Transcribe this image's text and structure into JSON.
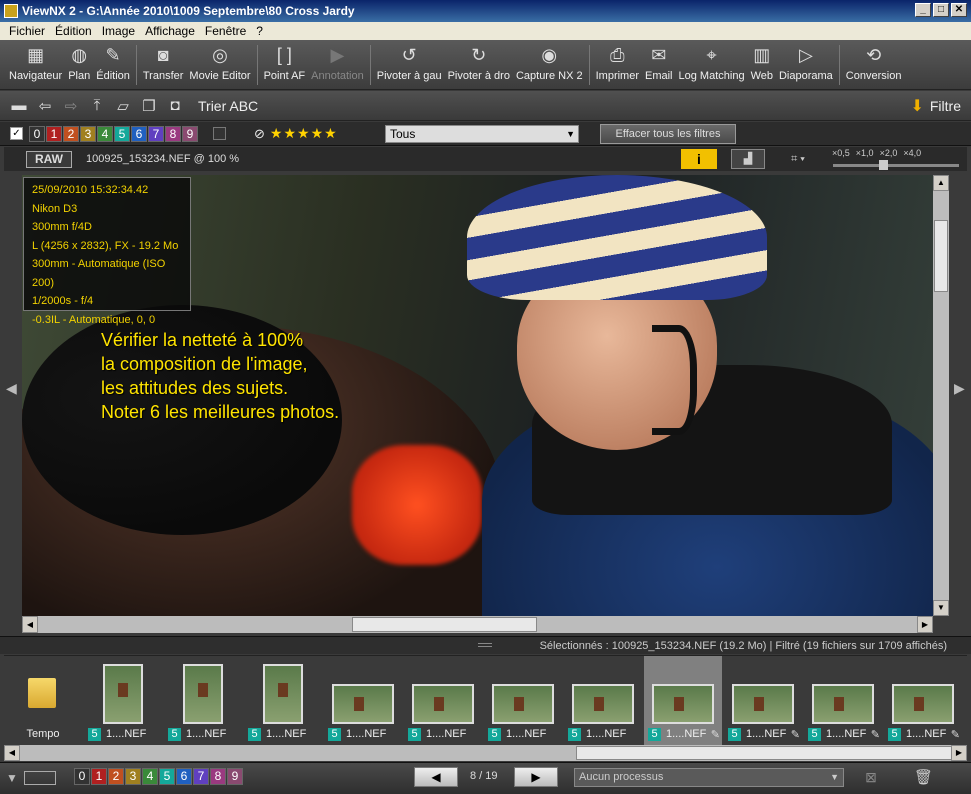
{
  "window": {
    "title": "ViewNX 2 - G:\\Année 2010\\1009 Septembre\\80 Cross Jardy"
  },
  "menu": [
    "Fichier",
    "Édition",
    "Image",
    "Affichage",
    "Fenêtre",
    "?"
  ],
  "toolbar": [
    {
      "label": "Navigateur",
      "icon": "navigator-icon",
      "glyph": "▦",
      "enabled": true
    },
    {
      "label": "Plan",
      "icon": "globe-icon",
      "glyph": "◍",
      "enabled": true
    },
    {
      "label": "Édition",
      "icon": "edit-icon",
      "glyph": "✎",
      "enabled": true
    },
    {
      "label": "Transfer",
      "icon": "camera-icon",
      "glyph": "◙",
      "enabled": true
    },
    {
      "label": "Movie Editor",
      "icon": "film-reel-icon",
      "glyph": "◎",
      "enabled": true
    },
    {
      "label": "Point AF",
      "icon": "af-point-icon",
      "glyph": "[ ]",
      "enabled": true
    },
    {
      "label": "Annotation",
      "icon": "play-icon",
      "glyph": "▶",
      "enabled": false
    },
    {
      "label": "Pivoter à gau",
      "icon": "rotate-left-icon",
      "glyph": "↺",
      "enabled": true
    },
    {
      "label": "Pivoter à dro",
      "icon": "rotate-right-icon",
      "glyph": "↻",
      "enabled": true
    },
    {
      "label": "Capture NX 2",
      "icon": "capture-nx-icon",
      "glyph": "◉",
      "enabled": true
    },
    {
      "label": "Imprimer",
      "icon": "printer-icon",
      "glyph": "⎙",
      "enabled": true
    },
    {
      "label": "Email",
      "icon": "email-icon",
      "glyph": "✉",
      "enabled": true
    },
    {
      "label": "Log Matching",
      "icon": "log-matching-icon",
      "glyph": "⌖",
      "enabled": true
    },
    {
      "label": "Web",
      "icon": "web-icon",
      "glyph": "▥",
      "enabled": true
    },
    {
      "label": "Diaporama",
      "icon": "slideshow-icon",
      "glyph": "▷",
      "enabled": true
    },
    {
      "label": "Conversion",
      "icon": "convert-icon",
      "glyph": "⟲",
      "enabled": true
    }
  ],
  "toolbar2": {
    "sort_label": "Trier ABC",
    "filter_label": "Filtre"
  },
  "filters": {
    "labels": [
      "0",
      "1",
      "2",
      "3",
      "4",
      "5",
      "6",
      "7",
      "8",
      "9"
    ],
    "label_colors": [
      "#444444",
      "#b02020",
      "#c05020",
      "#a08020",
      "#3a8a3a",
      "#14a89a",
      "#2060c0",
      "#6040c0",
      "#9a3a80",
      "#8a4a70"
    ],
    "rating_stars": 5,
    "dropdown_value": "Tous",
    "clear_button": "Effacer tous les filtres"
  },
  "viewer": {
    "raw_badge": "RAW",
    "file_zoom": "100925_153234.NEF @ 100 %",
    "info_button": "i",
    "zoom_ticks": [
      "×0,5",
      "×1,0",
      "×2,0",
      "×4,0"
    ],
    "zoom_level_fraction": 0.4
  },
  "exif": [
    "25/09/2010 15:32:34.42",
    "Nikon D3",
    "300mm f/4D",
    "L (4256 x 2832), FX - 19.2 Mo",
    "300mm - Automatique (ISO 200)",
    "1/2000s - f/4",
    "-0.3IL - Automatique, 0, 0"
  ],
  "overlay_note": [
    "Vérifier la netteté à 100%",
    "la composition de l'image,",
    "les attitudes des sujets.",
    "Noter 6 les meilleures photos."
  ],
  "status": {
    "text": "Sélectionnés : 100925_153234.NEF (19.2 Mo) | Filtré  (19 fichiers sur 1709 affichés)"
  },
  "thumbnails": [
    {
      "type": "folder",
      "label": "Tempo"
    },
    {
      "type": "photo",
      "orientation": "v",
      "badge": "5",
      "name": "1....NEF",
      "selected": false,
      "edited": false
    },
    {
      "type": "photo",
      "orientation": "v",
      "badge": "5",
      "name": "1....NEF",
      "selected": false,
      "edited": false
    },
    {
      "type": "photo",
      "orientation": "v",
      "badge": "5",
      "name": "1....NEF",
      "selected": false,
      "edited": false
    },
    {
      "type": "photo",
      "orientation": "h",
      "badge": "5",
      "name": "1....NEF",
      "selected": false,
      "edited": false
    },
    {
      "type": "photo",
      "orientation": "h",
      "badge": "5",
      "name": "1....NEF",
      "selected": false,
      "edited": false
    },
    {
      "type": "photo",
      "orientation": "h",
      "badge": "5",
      "name": "1....NEF",
      "selected": false,
      "edited": false
    },
    {
      "type": "photo",
      "orientation": "h",
      "badge": "5",
      "name": "1....NEF",
      "selected": false,
      "edited": false
    },
    {
      "type": "photo",
      "orientation": "h",
      "badge": "5",
      "name": "1....NEF",
      "selected": true,
      "edited": true
    },
    {
      "type": "photo",
      "orientation": "h",
      "badge": "5",
      "name": "1....NEF",
      "selected": false,
      "edited": true
    },
    {
      "type": "photo",
      "orientation": "h",
      "badge": "5",
      "name": "1....NEF",
      "selected": false,
      "edited": true
    },
    {
      "type": "photo",
      "orientation": "h",
      "badge": "5",
      "name": "1....NEF",
      "selected": false,
      "edited": true
    }
  ],
  "bottom": {
    "labels": [
      "0",
      "1",
      "2",
      "3",
      "4",
      "5",
      "6",
      "7",
      "8",
      "9"
    ],
    "prev": "◀",
    "next": "▶",
    "page": "8 / 19",
    "process": "Aucun processus"
  }
}
